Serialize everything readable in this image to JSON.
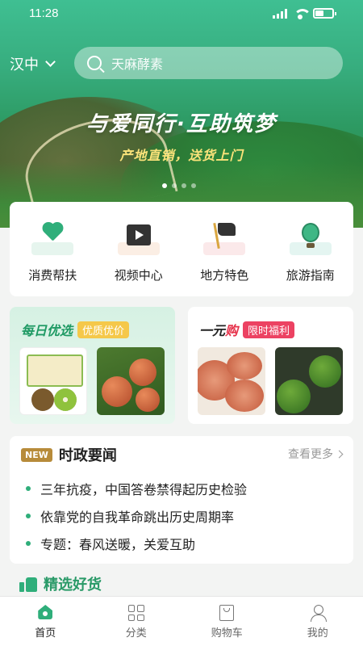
{
  "status": {
    "time": "11:28"
  },
  "header": {
    "city": "汉中",
    "search_placeholder": "天麻酵素"
  },
  "banner": {
    "slogan": "与爱同行·互助筑梦",
    "subtitle": "产地直销，送货上门",
    "dot_count": 4,
    "active_dot": 0
  },
  "categories": [
    {
      "label": "消费帮扶",
      "icon": "heart-hands-icon",
      "bg": "#e6f5ee"
    },
    {
      "label": "视频中心",
      "icon": "video-clapper-icon",
      "bg": "#fbeee4"
    },
    {
      "label": "地方特色",
      "icon": "flag-icon",
      "bg": "#fbe9ea"
    },
    {
      "label": "旅游指南",
      "icon": "hot-air-balloon-icon",
      "bg": "#e4f5f1"
    }
  ],
  "promos": {
    "daily": {
      "title": "每日优选",
      "tag": "优质优价"
    },
    "onebuy": {
      "title_prefix": "一元",
      "title_highlight": "购",
      "tag": "限时福利"
    }
  },
  "news": {
    "badge": "NEW",
    "title": "时政要闻",
    "more": "查看更多",
    "items": [
      "三年抗疫，中国答卷禁得起历史检验",
      "依靠党的自我革命跳出历史周期率",
      "专题：春风送暖，关爱互助"
    ]
  },
  "selected": {
    "title": "精选好货"
  },
  "tabs": [
    {
      "label": "首页",
      "icon": "home-icon",
      "active": true
    },
    {
      "label": "分类",
      "icon": "category-grid-icon",
      "active": false
    },
    {
      "label": "购物车",
      "icon": "shopping-cart-icon",
      "active": false
    },
    {
      "label": "我的",
      "icon": "user-icon",
      "active": false
    }
  ],
  "colors": {
    "brand": "#2fae7a",
    "accent_red": "#ec4262",
    "accent_yellow": "#f5c84a"
  }
}
